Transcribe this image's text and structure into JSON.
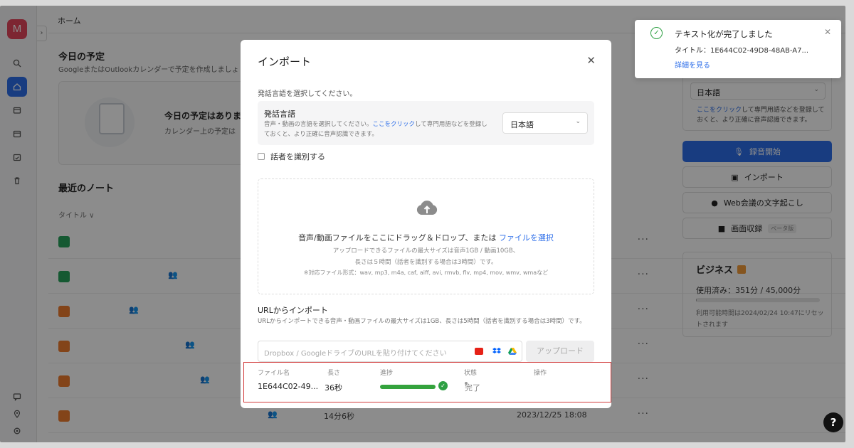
{
  "sidebar": {
    "avatar_letter": "M",
    "icons": [
      "search-icon",
      "home-icon",
      "folder-icon",
      "calendar-icon",
      "calendar-check-icon",
      "trash-icon"
    ],
    "bottom_icons": [
      "feedback-icon",
      "location-icon",
      "settings-icon"
    ]
  },
  "main": {
    "breadcrumb": "ホーム",
    "schedule_title": "今日の予定",
    "schedule_sub": "GoogleまたはOutlookカレンダーで予定を作成しましょ",
    "schedule_empty_title": "今日の予定はありま",
    "schedule_empty_text": "カレンダー上の予定は",
    "notes_title": "最近のノート",
    "notes_col_title": "タイトル ∨",
    "rows": [
      {
        "icon": "green",
        "people": "",
        "text": ""
      },
      {
        "icon": "green",
        "people": "👥",
        "text": ""
      },
      {
        "icon": "orange",
        "people": "👥",
        "text": ""
      },
      {
        "icon": "orange",
        "people": "👥",
        "text": ""
      },
      {
        "icon": "orange",
        "people": "👥",
        "text": ""
      },
      {
        "icon": "orange",
        "people": "👥",
        "duration": "14分6秒",
        "date": "2023/12/25 18:08"
      }
    ],
    "row_more": "···"
  },
  "right_panel": {
    "lang_value": "日本語",
    "link_text": "ここをクリック",
    "link_rest": "して専門用語などを登録しておくと、より正確に音声認識できます。",
    "record_btn": "録音開始",
    "import_btn": "インポート",
    "web_btn": "Web会議の文字起こし",
    "screen_btn": "画面収録",
    "screen_beta": "ベータ版",
    "plan_name": "ビジネス",
    "plan_used": "使用済み：351分 / 45,000分",
    "plan_used_fraction": 0.008,
    "plan_reset": "利用可能時間は2024/02/24 10:47にリセットされます"
  },
  "modal": {
    "title": "インポート",
    "lang_note": "発話言語を選択してください。",
    "lang_heading": "発話言語",
    "lang_desc_1": "音声・動画の言語を選択してください。",
    "lang_desc_link": "ここをクリック",
    "lang_desc_2": "して専門用語などを登録しておくと、より正確に音声認識できます。",
    "lang_value": "日本語",
    "speaker_label": "話者を識別する",
    "drop_main": "音声/動画ファイルをここにドラッグ＆ドロップ、または",
    "drop_link": "ファイルを選択",
    "drop_sub1": "アップロードできるファイルの最大サイズは音声1GB / 動画10GB、",
    "drop_sub2": "長さは５時間（話者を識別する場合は3時間）です。",
    "drop_sub3": "※対応ファイル形式：wav, mp3, m4a, caf, aiff, avi, rmvb, flv, mp4, mov, wmv, wmaなど",
    "url_heading": "URLからインポート",
    "url_desc": "URLからインポートできる音声・動画ファイルの最大サイズは1GB、長さは5時間（話者を識別する場合は3時間）です。",
    "url_placeholder": "Dropbox / GoogleドライブのURLを貼り付けてください",
    "upload_btn": "アップロード",
    "table_headers": {
      "name": "ファイル名",
      "length": "長さ",
      "progress": "進捗",
      "status": "状態",
      "action": "操作"
    },
    "table_row": {
      "name": "1E644C02-49...",
      "length": "36秒",
      "progress": 1.0,
      "status": "完了"
    }
  },
  "toast": {
    "title": "テキスト化が完了しました",
    "subtitle": "タイトル：1E644C02-49D8-48AB-A7...",
    "link": "詳細を見る"
  },
  "colors": {
    "accent": "#2d6ee9",
    "success": "#2ea043",
    "highlight": "#d23b3b"
  }
}
